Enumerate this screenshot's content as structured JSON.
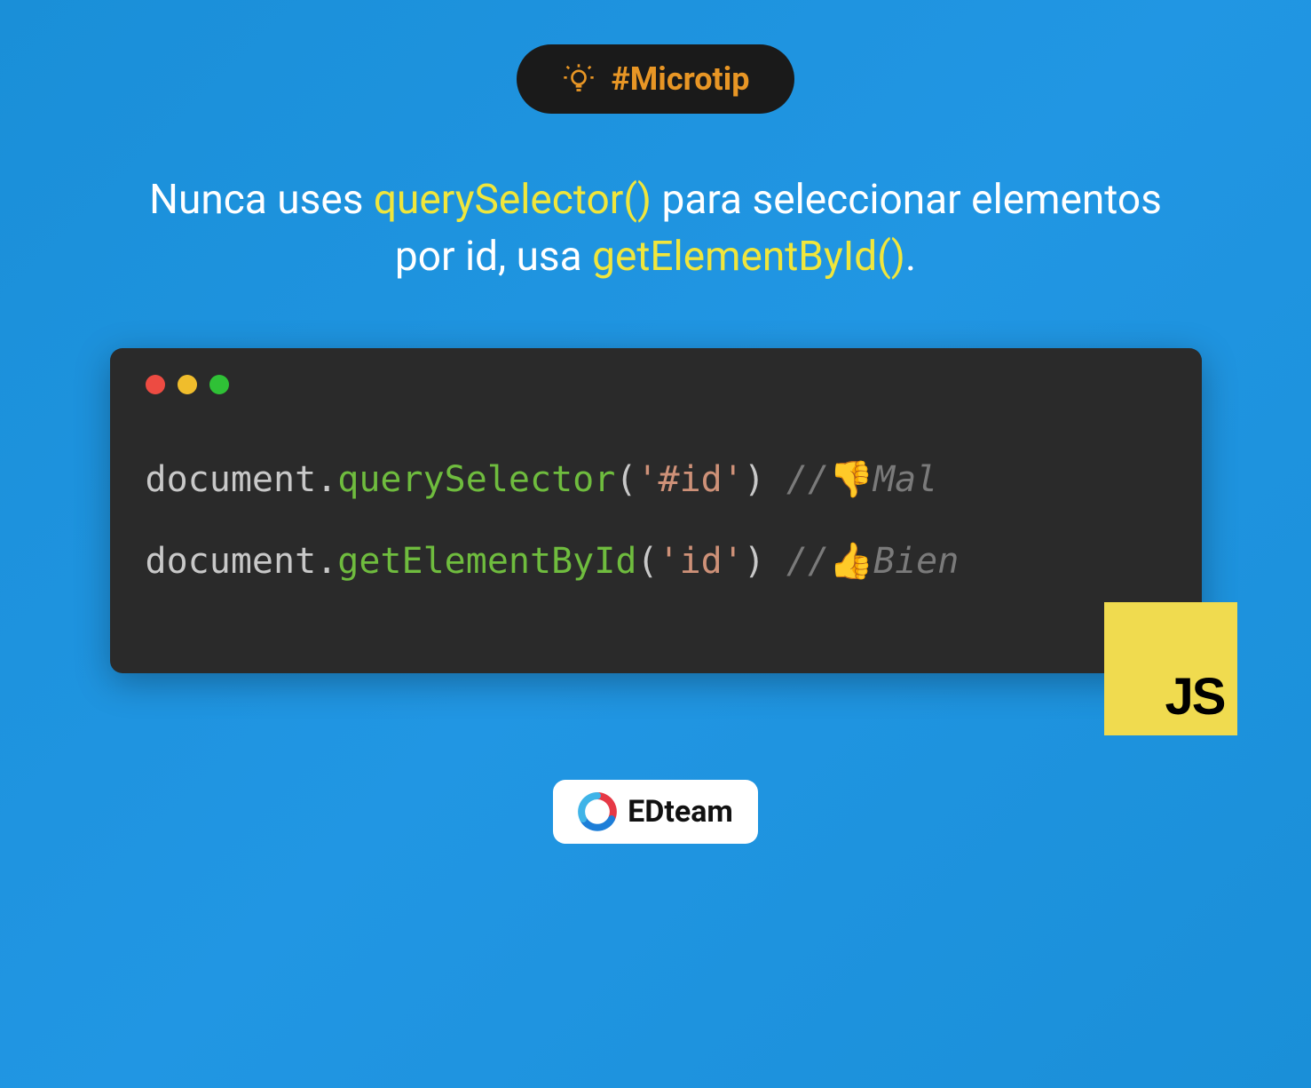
{
  "badge": {
    "icon_name": "lightbulb-icon",
    "text": "#Microtip"
  },
  "headline": {
    "part1": "Nunca uses ",
    "highlight1": "querySelector()",
    "part2": " para seleccionar elementos por id, usa ",
    "highlight2": "getElementById()",
    "part3": "."
  },
  "code": {
    "line1": {
      "obj": "document",
      "dot": ".",
      "method": "querySelector",
      "open": "(",
      "string": "'#id'",
      "close": ")",
      "space": " ",
      "comment_prefix": "//",
      "emoji": "👎",
      "comment_text": "Mal"
    },
    "line2": {
      "obj": "document",
      "dot": ".",
      "method": "getElementById",
      "open": "(",
      "string": "'id'",
      "close": ")",
      "space": " ",
      "comment_prefix": "//",
      "emoji": "👍",
      "comment_text": "Bien"
    }
  },
  "js_badge": "JS",
  "brand": {
    "name": "EDteam"
  },
  "colors": {
    "bg_blue": "#2196e3",
    "badge_dark": "#1a1a1a",
    "accent_orange": "#e89625",
    "highlight_yellow": "#f0e63c",
    "code_bg": "#2a2a2a",
    "js_yellow": "#f0db4f"
  }
}
